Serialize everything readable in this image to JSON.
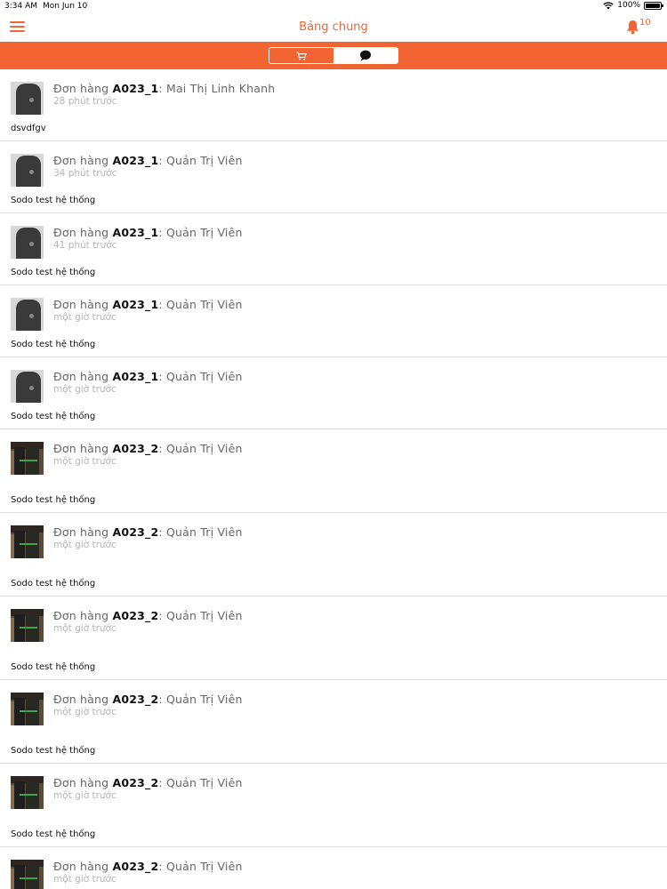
{
  "status_bar": {
    "time": "3:34 AM",
    "date": "Mon Jun 10",
    "battery": "100%"
  },
  "header": {
    "title": "Bảng chung",
    "notification_count": "10"
  },
  "segments": [
    {
      "icon": "cart-icon",
      "selected": false
    },
    {
      "icon": "chat-bubble-icon",
      "selected": true
    }
  ],
  "colors": {
    "accent": "#f26432"
  },
  "items": [
    {
      "prefix": "Đơn hàng ",
      "code": "A023_1",
      "author": ": Mai Thị Linh Khanh",
      "time": "28 phút trước",
      "message": "dsvdfgv",
      "thumb": "gray"
    },
    {
      "prefix": "Đơn hàng ",
      "code": "A023_1",
      "author": ": Quản Trị Viên",
      "time": "34 phút trước",
      "message": "Sodo test hệ thống",
      "thumb": "gray"
    },
    {
      "prefix": "Đơn hàng ",
      "code": "A023_1",
      "author": ": Quản Trị Viên",
      "time": "41 phút trước",
      "message": "Sodo test hệ thống",
      "thumb": "gray"
    },
    {
      "prefix": "Đơn hàng ",
      "code": "A023_1",
      "author": ": Quản Trị Viên",
      "time": "một giờ trước",
      "message": "Sodo test hệ thống",
      "thumb": "gray"
    },
    {
      "prefix": "Đơn hàng ",
      "code": "A023_1",
      "author": ": Quản Trị Viên",
      "time": "một giờ trước",
      "message": "Sodo test hệ thống",
      "thumb": "gray"
    },
    {
      "prefix": "Đơn hàng ",
      "code": "A023_2",
      "author": ": Quản Trị Viên",
      "time": "một giờ trước",
      "message": "Sodo test hệ thống",
      "thumb": "rack"
    },
    {
      "prefix": "Đơn hàng ",
      "code": "A023_2",
      "author": ": Quản Trị Viên",
      "time": "một giờ trước",
      "message": "Sodo test hệ thống",
      "thumb": "rack"
    },
    {
      "prefix": "Đơn hàng ",
      "code": "A023_2",
      "author": ": Quản Trị Viên",
      "time": "một giờ trước",
      "message": "Sodo test hệ thống",
      "thumb": "rack"
    },
    {
      "prefix": "Đơn hàng ",
      "code": "A023_2",
      "author": ": Quản Trị Viên",
      "time": "một giờ trước",
      "message": "Sodo test hệ thống",
      "thumb": "rack"
    },
    {
      "prefix": "Đơn hàng ",
      "code": "A023_2",
      "author": ": Quản Trị Viên",
      "time": "một giờ trước",
      "message": "Sodo test hệ thống",
      "thumb": "rack"
    },
    {
      "prefix": "Đơn hàng ",
      "code": "A023_2",
      "author": ": Quản Trị Viên",
      "time": "một giờ trước",
      "message": "",
      "thumb": "rack"
    }
  ]
}
